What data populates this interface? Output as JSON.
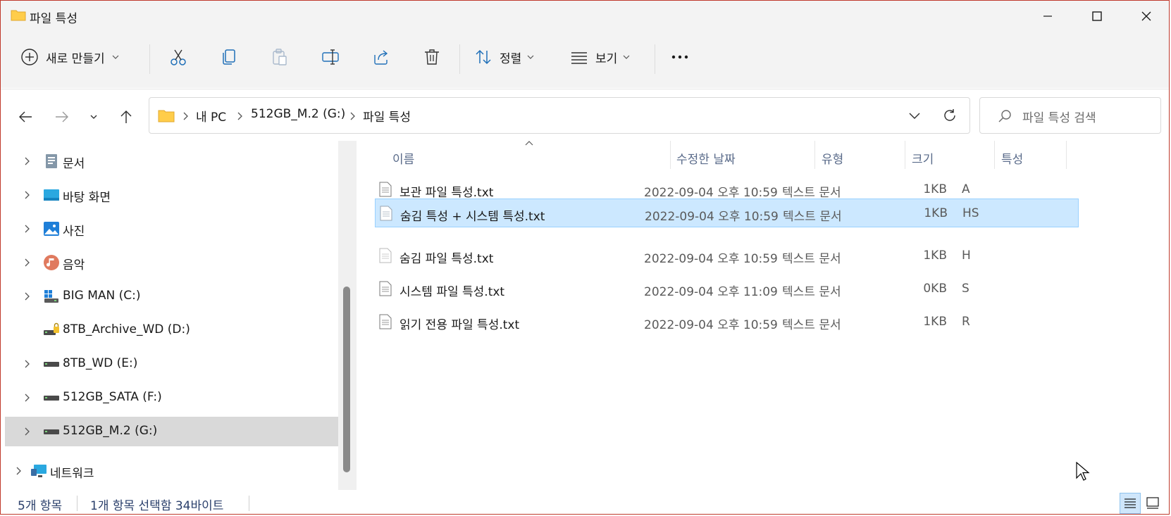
{
  "window": {
    "title": "파일 특성",
    "minimize_icon": "minimize-icon",
    "maximize_icon": "maximize-icon",
    "close_icon": "close-icon"
  },
  "toolbar": {
    "new_label": "새로 만들기",
    "sort_label": "정렬",
    "view_label": "보기",
    "icons": [
      "cut-icon",
      "copy-icon",
      "paste-icon",
      "rename-icon",
      "share-icon",
      "delete-icon",
      "more-icon"
    ]
  },
  "address": {
    "crumbs": [
      "내 PC",
      "512GB_M.2 (G:)",
      "파일 특성"
    ],
    "search_placeholder": "파일 특성 검색"
  },
  "sidebar": {
    "items": [
      {
        "label": "문서",
        "icon": "documents-icon",
        "has_chevron": true
      },
      {
        "label": "바탕 화면",
        "icon": "desktop-icon",
        "has_chevron": true
      },
      {
        "label": "사진",
        "icon": "pictures-icon",
        "has_chevron": true
      },
      {
        "label": "음악",
        "icon": "music-icon",
        "has_chevron": true
      },
      {
        "label": "BIG MAN (C:)",
        "icon": "system-drive-icon",
        "has_chevron": true
      },
      {
        "label": "8TB_Archive_WD (D:)",
        "icon": "locked-drive-icon",
        "has_chevron": false
      },
      {
        "label": "8TB_WD (E:)",
        "icon": "drive-icon",
        "has_chevron": true
      },
      {
        "label": "512GB_SATA (F:)",
        "icon": "drive-icon",
        "has_chevron": true
      },
      {
        "label": "512GB_M.2 (G:)",
        "icon": "drive-icon",
        "has_chevron": true,
        "selected": true
      },
      {
        "label": "네트워크",
        "icon": "network-icon",
        "has_chevron": true
      }
    ]
  },
  "columns": {
    "name": "이름",
    "modified": "수정한 날짜",
    "type": "유형",
    "size": "크기",
    "attributes": "특성"
  },
  "files": [
    {
      "name": "보관 파일 특성.txt",
      "modified": "2022-09-04 오후 10:59",
      "type": "텍스트 문서",
      "size": "1KB",
      "attr": "A"
    },
    {
      "name": "숨김 특성 + 시스템 특성.txt",
      "modified": "2022-09-04 오후 10:59",
      "type": "텍스트 문서",
      "size": "1KB",
      "attr": "HS",
      "selected": true
    },
    {
      "name": "숨김 파일 특성.txt",
      "modified": "2022-09-04 오후 10:59",
      "type": "텍스트 문서",
      "size": "1KB",
      "attr": "H"
    },
    {
      "name": "시스템 파일 특성.txt",
      "modified": "2022-09-04 오후 11:09",
      "type": "텍스트 문서",
      "size": "0KB",
      "attr": "S"
    },
    {
      "name": "읽기 전용 파일 특성.txt",
      "modified": "2022-09-04 오후 10:59",
      "type": "텍스트 문서",
      "size": "1KB",
      "attr": "R"
    }
  ],
  "status": {
    "count": "5개 항목",
    "selection": "1개 항목 선택함 34바이트"
  },
  "colors": {
    "accent": "#0067c0",
    "selection_bg": "#cce8ff",
    "selection_border": "#99d1ff",
    "window_border": "#c0392b"
  }
}
